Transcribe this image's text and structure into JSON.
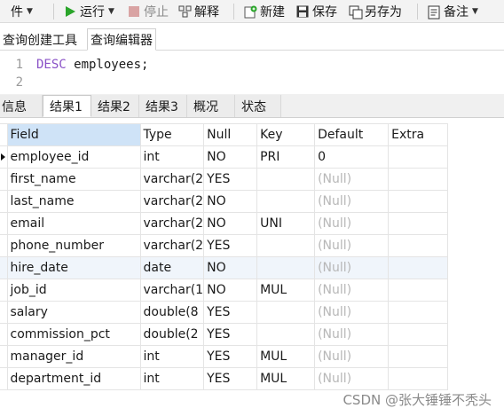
{
  "toolbar": {
    "menu_label": "件",
    "run": "运行",
    "stop": "停止",
    "explain": "解释",
    "new": "新建",
    "save": "保存",
    "save_as": "另存为",
    "note": "备注",
    "accent_color": "#2aa52a"
  },
  "query_tabs": [
    "查询创建工具",
    "查询编辑器"
  ],
  "editor": {
    "lines": [
      {
        "num": "1",
        "keyword": "DESC",
        "rest": " employees;"
      },
      {
        "num": "2",
        "keyword": "",
        "rest": ""
      }
    ]
  },
  "result_tabs": [
    "信息",
    "结果1",
    "结果2",
    "结果3",
    "概况",
    "状态"
  ],
  "table": {
    "columns": [
      "Field",
      "Type",
      "Null",
      "Key",
      "Default",
      "Extra"
    ],
    "rows": [
      [
        "employee_id",
        "int",
        "NO",
        "PRI",
        "0",
        ""
      ],
      [
        "first_name",
        "varchar(2",
        "YES",
        "",
        "(Null)",
        ""
      ],
      [
        "last_name",
        "varchar(2",
        "NO",
        "",
        "(Null)",
        ""
      ],
      [
        "email",
        "varchar(2",
        "NO",
        "UNI",
        "(Null)",
        ""
      ],
      [
        "phone_number",
        "varchar(2",
        "YES",
        "",
        "(Null)",
        ""
      ],
      [
        "hire_date",
        "date",
        "NO",
        "",
        "(Null)",
        ""
      ],
      [
        "job_id",
        "varchar(1",
        "NO",
        "MUL",
        "(Null)",
        ""
      ],
      [
        "salary",
        "double(8",
        "YES",
        "",
        "(Null)",
        ""
      ],
      [
        "commission_pct",
        "double(2",
        "YES",
        "",
        "(Null)",
        ""
      ],
      [
        "manager_id",
        "int",
        "YES",
        "MUL",
        "(Null)",
        ""
      ],
      [
        "department_id",
        "int",
        "YES",
        "MUL",
        "(Null)",
        ""
      ]
    ]
  },
  "watermark": "CSDN @张大锤锤不秃头"
}
